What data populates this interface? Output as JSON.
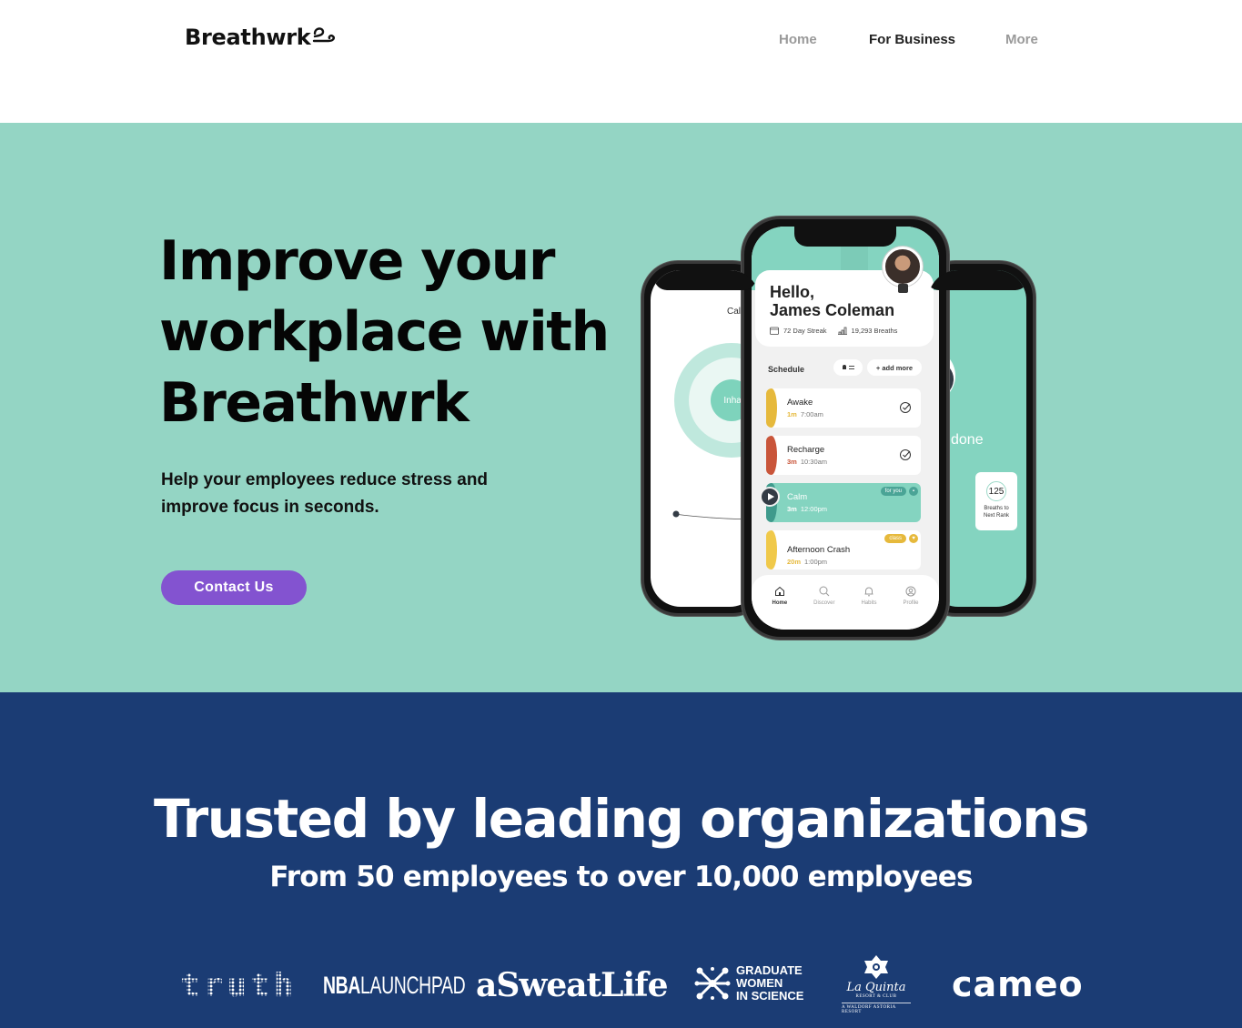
{
  "header": {
    "logo_text": "Breathwrk",
    "nav": [
      {
        "label": "Home",
        "active": false
      },
      {
        "label": "For Business",
        "active": true
      },
      {
        "label": "More",
        "active": false
      }
    ]
  },
  "hero": {
    "title": "Improve your workplace with Breathwrk",
    "subtitle": "Help your employees reduce stress and improve focus in seconds.",
    "cta_label": "Contact Us",
    "colors": {
      "background": "#94d5c4",
      "cta": "#8353d0"
    }
  },
  "phone_left": {
    "session_label": "Calm",
    "breath_label": "Inhale"
  },
  "phone_main": {
    "greeting": "Hello,",
    "user_name": "James Coleman",
    "streak": "72 Day Streak",
    "breaths": "19,293 Breaths",
    "schedule_label": "Schedule",
    "add_more_label": "+ add more",
    "schedule": [
      {
        "name": "Awake",
        "duration": "1m",
        "time": "7:00am",
        "color": "#e6b93c",
        "done": true
      },
      {
        "name": "Recharge",
        "duration": "3m",
        "time": "10:30am",
        "color": "#c9553a",
        "done": true
      },
      {
        "name": "Calm",
        "duration": "3m",
        "time": "12:00pm",
        "color": "#3f9a8c",
        "tag": "for you"
      },
      {
        "name": "Afternoon Crash",
        "duration": "20m",
        "time": "1:00pm",
        "color": "#f0c94a",
        "tag": "class"
      }
    ],
    "tabs": [
      {
        "label": "Home",
        "icon": "home-icon",
        "active": true
      },
      {
        "label": "Discover",
        "icon": "search-icon",
        "active": false
      },
      {
        "label": "Habits",
        "icon": "bell-icon",
        "active": false
      },
      {
        "label": "Profile",
        "icon": "profile-icon",
        "active": false
      }
    ]
  },
  "phone_right": {
    "done_text": "done",
    "stat_value": "125",
    "stat_label": "Breaths to Next Rank"
  },
  "trusted": {
    "title": "Trusted by leading organizations",
    "subtitle": "From 50 employees to over 10,000 employees",
    "logos": {
      "truth": "truth",
      "nba_bold": "NBA",
      "nba_rest": "LAUNCHPAD",
      "sweat": "aSweatLife",
      "gwis": [
        "GRADUATE",
        "WOMEN",
        "IN SCIENCE"
      ],
      "laquinta": "La Quinta",
      "laquinta_sub": "RESORT & CLUB",
      "laquinta_tag": "A WALDORF ASTORIA RESORT",
      "cameo": "cameo"
    },
    "colors": {
      "background": "#1b3c74"
    }
  }
}
